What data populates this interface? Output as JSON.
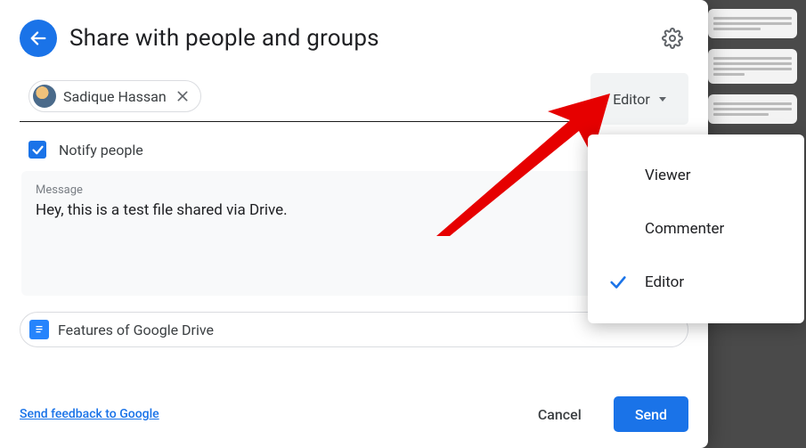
{
  "header": {
    "title": "Share with people and groups"
  },
  "recipient": {
    "name": "Sadique Hassan"
  },
  "role_select": {
    "current": "Editor",
    "options": {
      "viewer": "Viewer",
      "commenter": "Commenter",
      "editor": "Editor"
    },
    "selected_key": "editor"
  },
  "notify": {
    "label": "Notify people",
    "checked": true
  },
  "message": {
    "label": "Message",
    "text": "Hey, this is a test file shared via Drive."
  },
  "file": {
    "name": "Features of Google Drive"
  },
  "footer": {
    "feedback": "Send feedback to Google",
    "cancel": "Cancel",
    "send": "Send"
  }
}
